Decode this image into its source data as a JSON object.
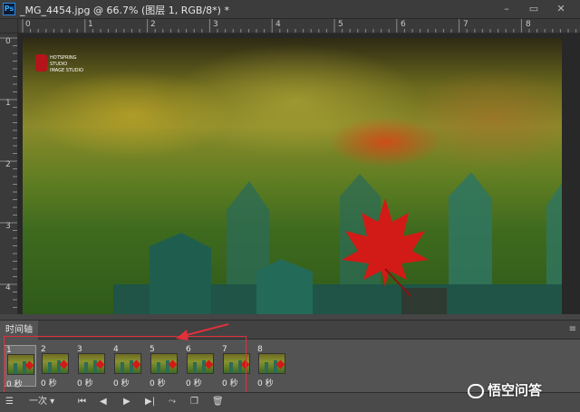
{
  "app": {
    "logo_text": "Ps"
  },
  "document": {
    "title": "_MG_4454.jpg @ 66.7% (图层 1, RGB/8*) *"
  },
  "window_controls": {
    "minimize": "–",
    "maximize": "▭",
    "close": "✕"
  },
  "rulers": {
    "horizontal": [
      "0",
      "1",
      "2",
      "3",
      "4",
      "5",
      "6",
      "7",
      "8"
    ],
    "vertical": [
      "0",
      "1",
      "2",
      "3",
      "4"
    ]
  },
  "photo": {
    "logo_lines": [
      "HOTSPRING",
      "STUDIO",
      "IMAGE STUDIO"
    ],
    "colors": {
      "fence": "#2b6b58",
      "leaf": "#d21a16",
      "bokeh": "#8a8a2a"
    }
  },
  "timeline": {
    "tab_label": "时间轴",
    "frames": [
      {
        "number": "1",
        "delay": "0 秒",
        "selected": true
      },
      {
        "number": "2",
        "delay": "0 秒",
        "selected": false
      },
      {
        "number": "3",
        "delay": "0 秒",
        "selected": false
      },
      {
        "number": "4",
        "delay": "0 秒",
        "selected": false
      },
      {
        "number": "5",
        "delay": "0 秒",
        "selected": false
      },
      {
        "number": "6",
        "delay": "0 秒",
        "selected": false
      },
      {
        "number": "7",
        "delay": "0 秒",
        "selected": false
      },
      {
        "number": "8",
        "delay": "0 秒",
        "selected": false
      }
    ],
    "loop_option": "一次",
    "highlight_color": "#e0303a"
  },
  "watermark": {
    "text": "悟空问答"
  }
}
